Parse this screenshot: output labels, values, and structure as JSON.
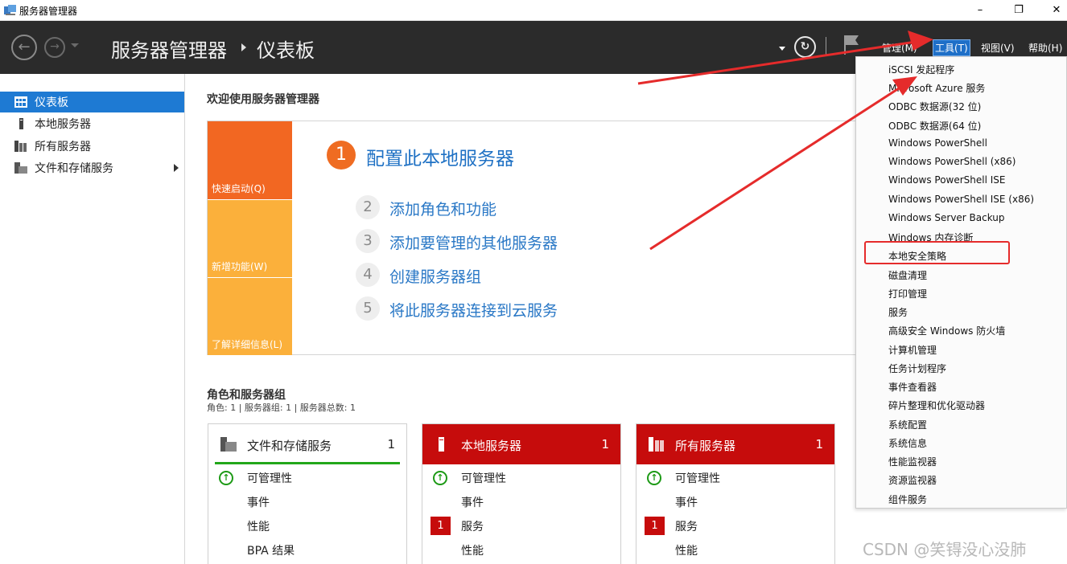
{
  "window": {
    "title": "服务器管理器",
    "minimize": "–",
    "maximize": "❐",
    "close": "✕"
  },
  "header": {
    "back_glyph": "←",
    "forward_glyph": "→",
    "breadcrumb_app": "服务器管理器",
    "breadcrumb_page": "仪表板",
    "refresh_glyph": "↻",
    "menus": {
      "manage": "管理(M)",
      "tools": "工具(T)",
      "view": "视图(V)",
      "help": "帮助(H)"
    }
  },
  "sidebar": {
    "items": [
      {
        "label": "仪表板",
        "icon": "dashboard-icon",
        "selected": true
      },
      {
        "label": "本地服务器",
        "icon": "server-icon"
      },
      {
        "label": "所有服务器",
        "icon": "servers-icon"
      },
      {
        "label": "文件和存储服务",
        "icon": "storage-icon",
        "expandable": true
      }
    ]
  },
  "welcome": {
    "title": "欢迎使用服务器管理器",
    "tiles": {
      "quick_start": "快速启动(Q)",
      "whats_new": "新增功能(W)",
      "learn_more": "了解详细信息(L)"
    },
    "steps": [
      {
        "num": "1",
        "text": "配置此本地服务器"
      },
      {
        "num": "2",
        "text": "添加角色和功能"
      },
      {
        "num": "3",
        "text": "添加要管理的其他服务器"
      },
      {
        "num": "4",
        "text": "创建服务器组"
      },
      {
        "num": "5",
        "text": "将此服务器连接到云服务"
      }
    ]
  },
  "roles": {
    "title": "角色和服务器组",
    "subtitle": "角色: 1 | 服务器组: 1 | 服务器总数: 1",
    "cards": [
      {
        "name": "文件和存储服务",
        "count": "1",
        "status": "normal",
        "rows": [
          {
            "mark": "ok",
            "badge": "",
            "label": "可管理性"
          },
          {
            "mark": "",
            "badge": "",
            "label": "事件"
          },
          {
            "mark": "",
            "badge": "",
            "label": "性能"
          },
          {
            "mark": "",
            "badge": "",
            "label": "BPA 结果"
          }
        ]
      },
      {
        "name": "本地服务器",
        "count": "1",
        "status": "alert",
        "rows": [
          {
            "mark": "ok",
            "badge": "",
            "label": "可管理性"
          },
          {
            "mark": "",
            "badge": "",
            "label": "事件"
          },
          {
            "mark": "badge",
            "badge": "1",
            "label": "服务"
          },
          {
            "mark": "",
            "badge": "",
            "label": "性能"
          }
        ]
      },
      {
        "name": "所有服务器",
        "count": "1",
        "status": "alert",
        "rows": [
          {
            "mark": "ok",
            "badge": "",
            "label": "可管理性"
          },
          {
            "mark": "",
            "badge": "",
            "label": "事件"
          },
          {
            "mark": "badge",
            "badge": "1",
            "label": "服务"
          },
          {
            "mark": "",
            "badge": "",
            "label": "性能"
          }
        ]
      }
    ],
    "ok_glyph": "↑"
  },
  "tools_menu": {
    "items": [
      "iSCSI 发起程序",
      "Microsoft Azure 服务",
      "ODBC 数据源(32 位)",
      "ODBC 数据源(64 位)",
      "Windows PowerShell",
      "Windows PowerShell (x86)",
      "Windows PowerShell ISE",
      "Windows PowerShell ISE (x86)",
      "Windows Server Backup",
      "Windows 内存诊断",
      "本地安全策略",
      "磁盘清理",
      "打印管理",
      "服务",
      "高级安全 Windows 防火墙",
      "计算机管理",
      "任务计划程序",
      "事件查看器",
      "碎片整理和优化驱动器",
      "系统配置",
      "系统信息",
      "性能监视器",
      "资源监视器",
      "组件服务"
    ],
    "highlighted": "本地安全策略"
  },
  "watermark": "CSDN @笑锝没心没肺",
  "colors": {
    "header_bg": "#2b2b2b",
    "accent_blue": "#1e7ad3",
    "alert_red": "#c60c0c",
    "quick_orange": "#f26722",
    "tile_yellow": "#fbb03b",
    "annotation_red": "#e52b2b"
  }
}
